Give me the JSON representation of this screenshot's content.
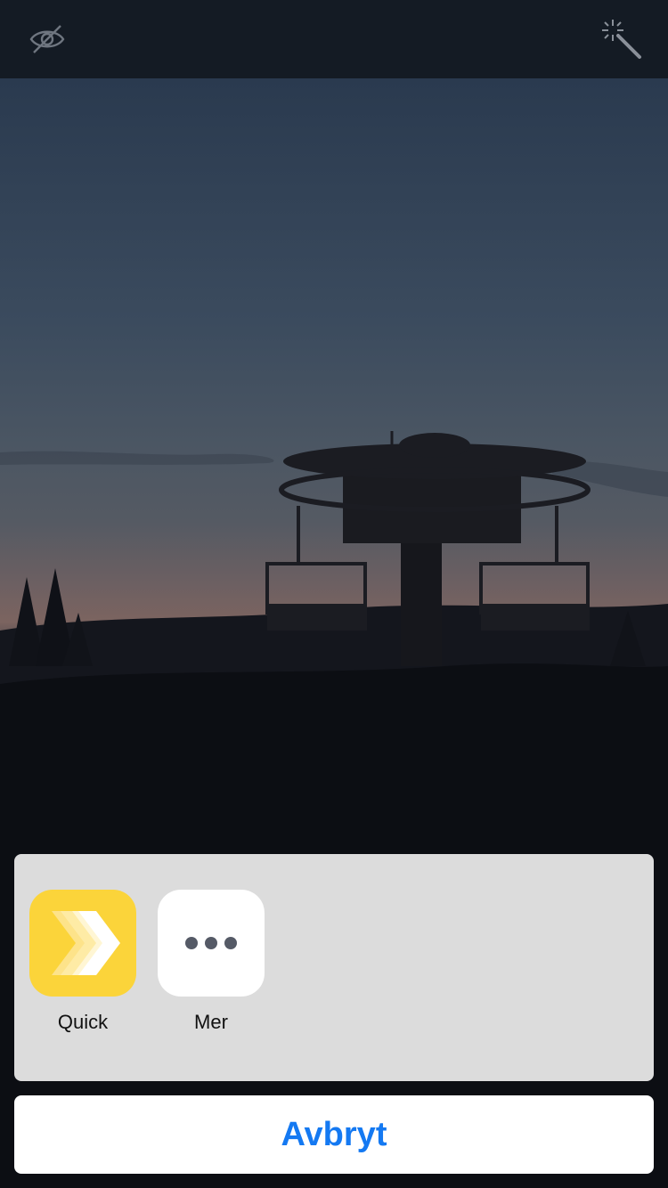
{
  "topbar": {
    "left_icon": "eye-slash-icon",
    "right_icon": "magic-wand-icon"
  },
  "photo": {
    "description_icon": "photo"
  },
  "share_sheet": {
    "apps": [
      {
        "label": "Quick",
        "icon": "quick-chevron-icon",
        "color": "#fbd43a"
      },
      {
        "label": "Mer",
        "icon": "more-dots-icon",
        "color": "#ffffff"
      }
    ]
  },
  "cancel_button": {
    "label": "Avbryt",
    "color": "#1479f2"
  }
}
